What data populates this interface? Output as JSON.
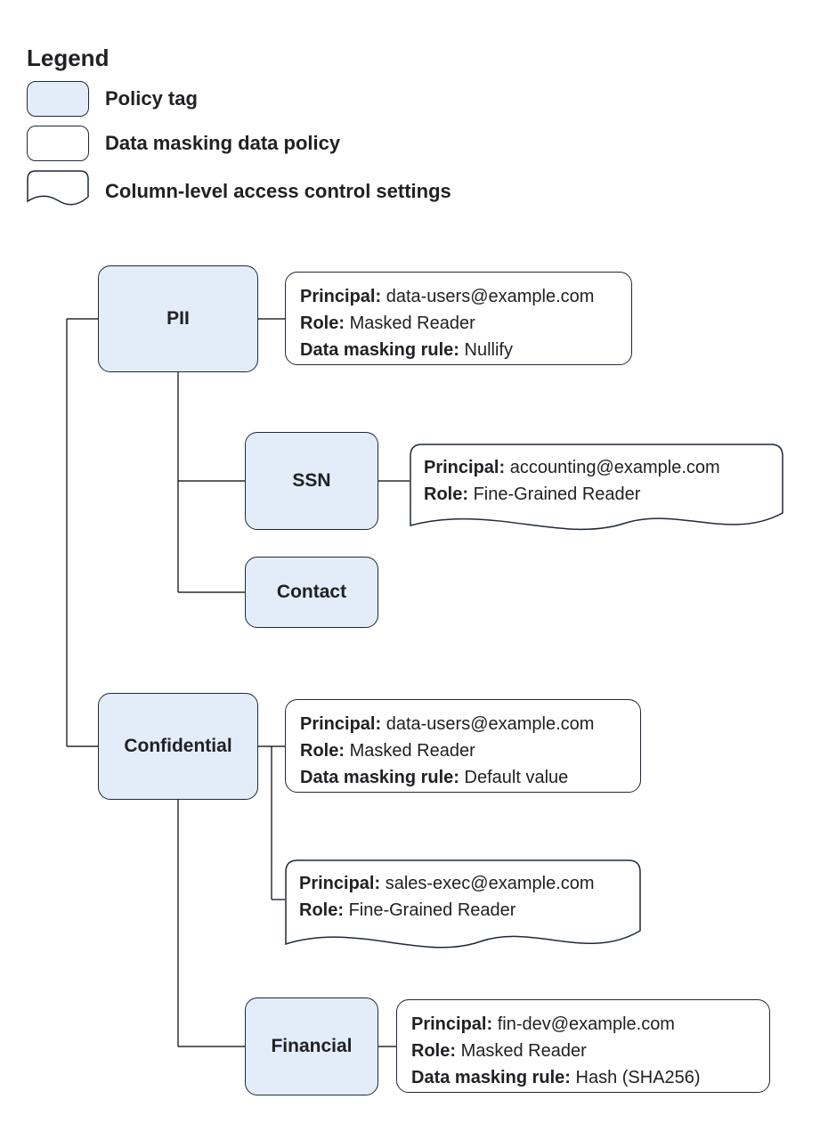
{
  "legend": {
    "title": "Legend",
    "items": {
      "tag": "Policy tag",
      "policy": "Data masking data policy",
      "acl": "Column-level access control settings"
    }
  },
  "labels": {
    "principal": "Principal:",
    "role": "Role:",
    "rule": "Data masking rule:"
  },
  "nodes": {
    "pii": {
      "name": "PII"
    },
    "pii_policy": {
      "principal": "data-users@example.com",
      "role": "Masked Reader",
      "rule": "Nullify"
    },
    "ssn": {
      "name": "SSN"
    },
    "ssn_acl": {
      "principal": "accounting@example.com",
      "role": "Fine-Grained Reader"
    },
    "contact": {
      "name": "Contact"
    },
    "confidential": {
      "name": "Confidential"
    },
    "confidential_policy": {
      "principal": "data-users@example.com",
      "role": "Masked Reader",
      "rule": "Default value"
    },
    "confidential_acl": {
      "principal": "sales-exec@example.com",
      "role": "Fine-Grained Reader"
    },
    "financial": {
      "name": "Financial"
    },
    "financial_policy": {
      "principal": "fin-dev@example.com",
      "role": "Masked Reader",
      "rule": "Hash (SHA256)"
    }
  }
}
